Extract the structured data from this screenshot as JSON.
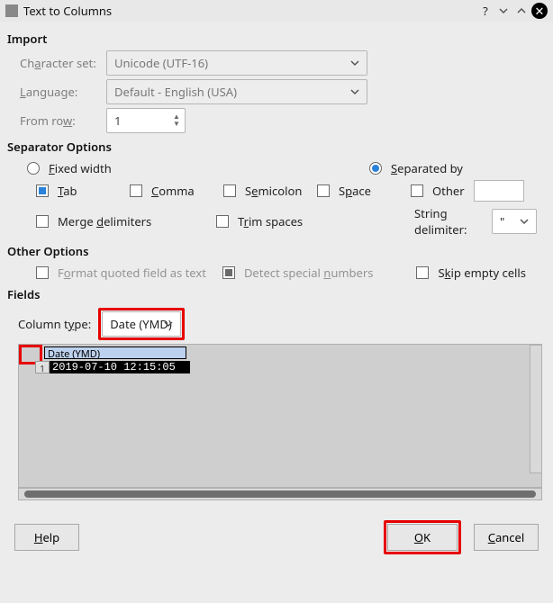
{
  "window": {
    "title": "Text to Columns"
  },
  "import": {
    "heading": "Import",
    "charset_label_pre": "Ch",
    "charset_label_ul": "a",
    "charset_label_post": "racter set:",
    "charset_value": "Unicode (UTF-16)",
    "language_label_pre": "",
    "language_label_ul": "L",
    "language_label_post": "anguage:",
    "language_value": "Default - English (USA)",
    "fromrow_label_pre": "From ro",
    "fromrow_label_ul": "w",
    "fromrow_label_post": ":",
    "fromrow_value": "1"
  },
  "separator": {
    "heading": "Separator Options",
    "fixed_pre": "",
    "fixed_ul": "F",
    "fixed_post": "ixed width",
    "separated_pre": "",
    "separated_ul": "S",
    "separated_post": "eparated by",
    "tab_pre": "",
    "tab_ul": "T",
    "tab_post": "ab",
    "comma_pre": "",
    "comma_ul": "C",
    "comma_post": "omma",
    "semicolon_pre": "S",
    "semicolon_ul": "e",
    "semicolon_post": "micolon",
    "space_pre": "S",
    "space_ul": "p",
    "space_post": "ace",
    "other_label": "Other",
    "merge_pre": "Merge ",
    "merge_ul": "d",
    "merge_post": "elimiters",
    "trim_pre": "T",
    "trim_ul": "r",
    "trim_post": "im spaces",
    "stringdel_label": "Strin",
    "stringdel_ul": "g",
    "stringdel_post": " delimiter:",
    "stringdel_value": "\""
  },
  "other": {
    "heading": "Other Options",
    "format_pre": "F",
    "format_ul": "o",
    "format_post": "rmat quoted field as text",
    "detect_pre": "Detect special ",
    "detect_ul": "n",
    "detect_post": "umbers",
    "skip_pre": "S",
    "skip_ul": "k",
    "skip_post": "ip empty cells"
  },
  "fields": {
    "heading": "Fields",
    "coltype_label_pre": "Column t",
    "coltype_label_ul": "y",
    "coltype_label_post": "pe:",
    "coltype_value": "Date (YMD)",
    "preview_header": "Date (YMD)",
    "preview_rownum": "1",
    "preview_cell": "2019-07-10 12:15:05"
  },
  "footer": {
    "help_ul": "H",
    "help_post": "elp",
    "ok_ul": "O",
    "ok_post": "K",
    "cancel_ul": "C",
    "cancel_post": "ancel"
  }
}
